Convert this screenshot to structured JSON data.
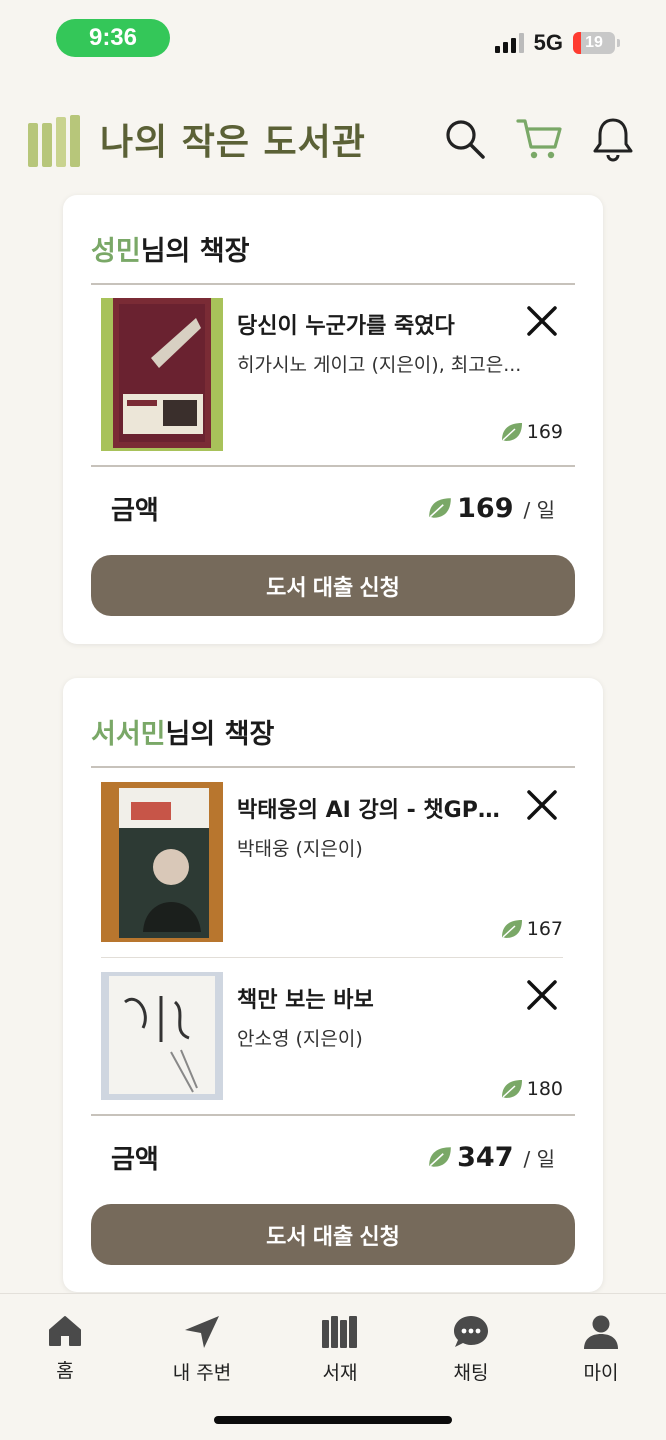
{
  "status_bar": {
    "time": "9:36",
    "network": "5G",
    "battery": "19",
    "battery_level": 0.19
  },
  "header": {
    "title": "나의 작은 도서관",
    "icons": [
      "search-icon",
      "cart-icon",
      "bell-icon"
    ]
  },
  "shelves": [
    {
      "owner": "성민",
      "suffix": "님의 책장",
      "books": [
        {
          "title": "당신이 누군가를 죽였다",
          "author": "히가시노 게이고 (지은이), 최고은...",
          "price": "169"
        }
      ],
      "total_label": "금액",
      "total": "169",
      "unit": "/ 일",
      "button": "도서 대출 신청"
    },
    {
      "owner": "서서민",
      "suffix": "님의 책장",
      "books": [
        {
          "title": "박태웅의 AI 강의 - 챗GPT...",
          "author": "박태웅 (지은이)",
          "price": "167"
        },
        {
          "title": "책만 보는 바보",
          "author": "안소영 (지은이)",
          "price": "180"
        }
      ],
      "total_label": "금액",
      "total": "347",
      "unit": "/ 일",
      "button": "도서 대출 신청"
    }
  ],
  "bottom_nav": [
    {
      "label": "홈",
      "icon": "home-icon"
    },
    {
      "label": "내 주변",
      "icon": "location-arrow-icon"
    },
    {
      "label": "서재",
      "icon": "bookshelf-icon"
    },
    {
      "label": "채팅",
      "icon": "chat-icon"
    },
    {
      "label": "마이",
      "icon": "person-icon"
    }
  ],
  "colors": {
    "accent": "#7aa867",
    "brand_title": "#5b6136",
    "button": "#766a5b",
    "leaf": "#7aa867"
  }
}
